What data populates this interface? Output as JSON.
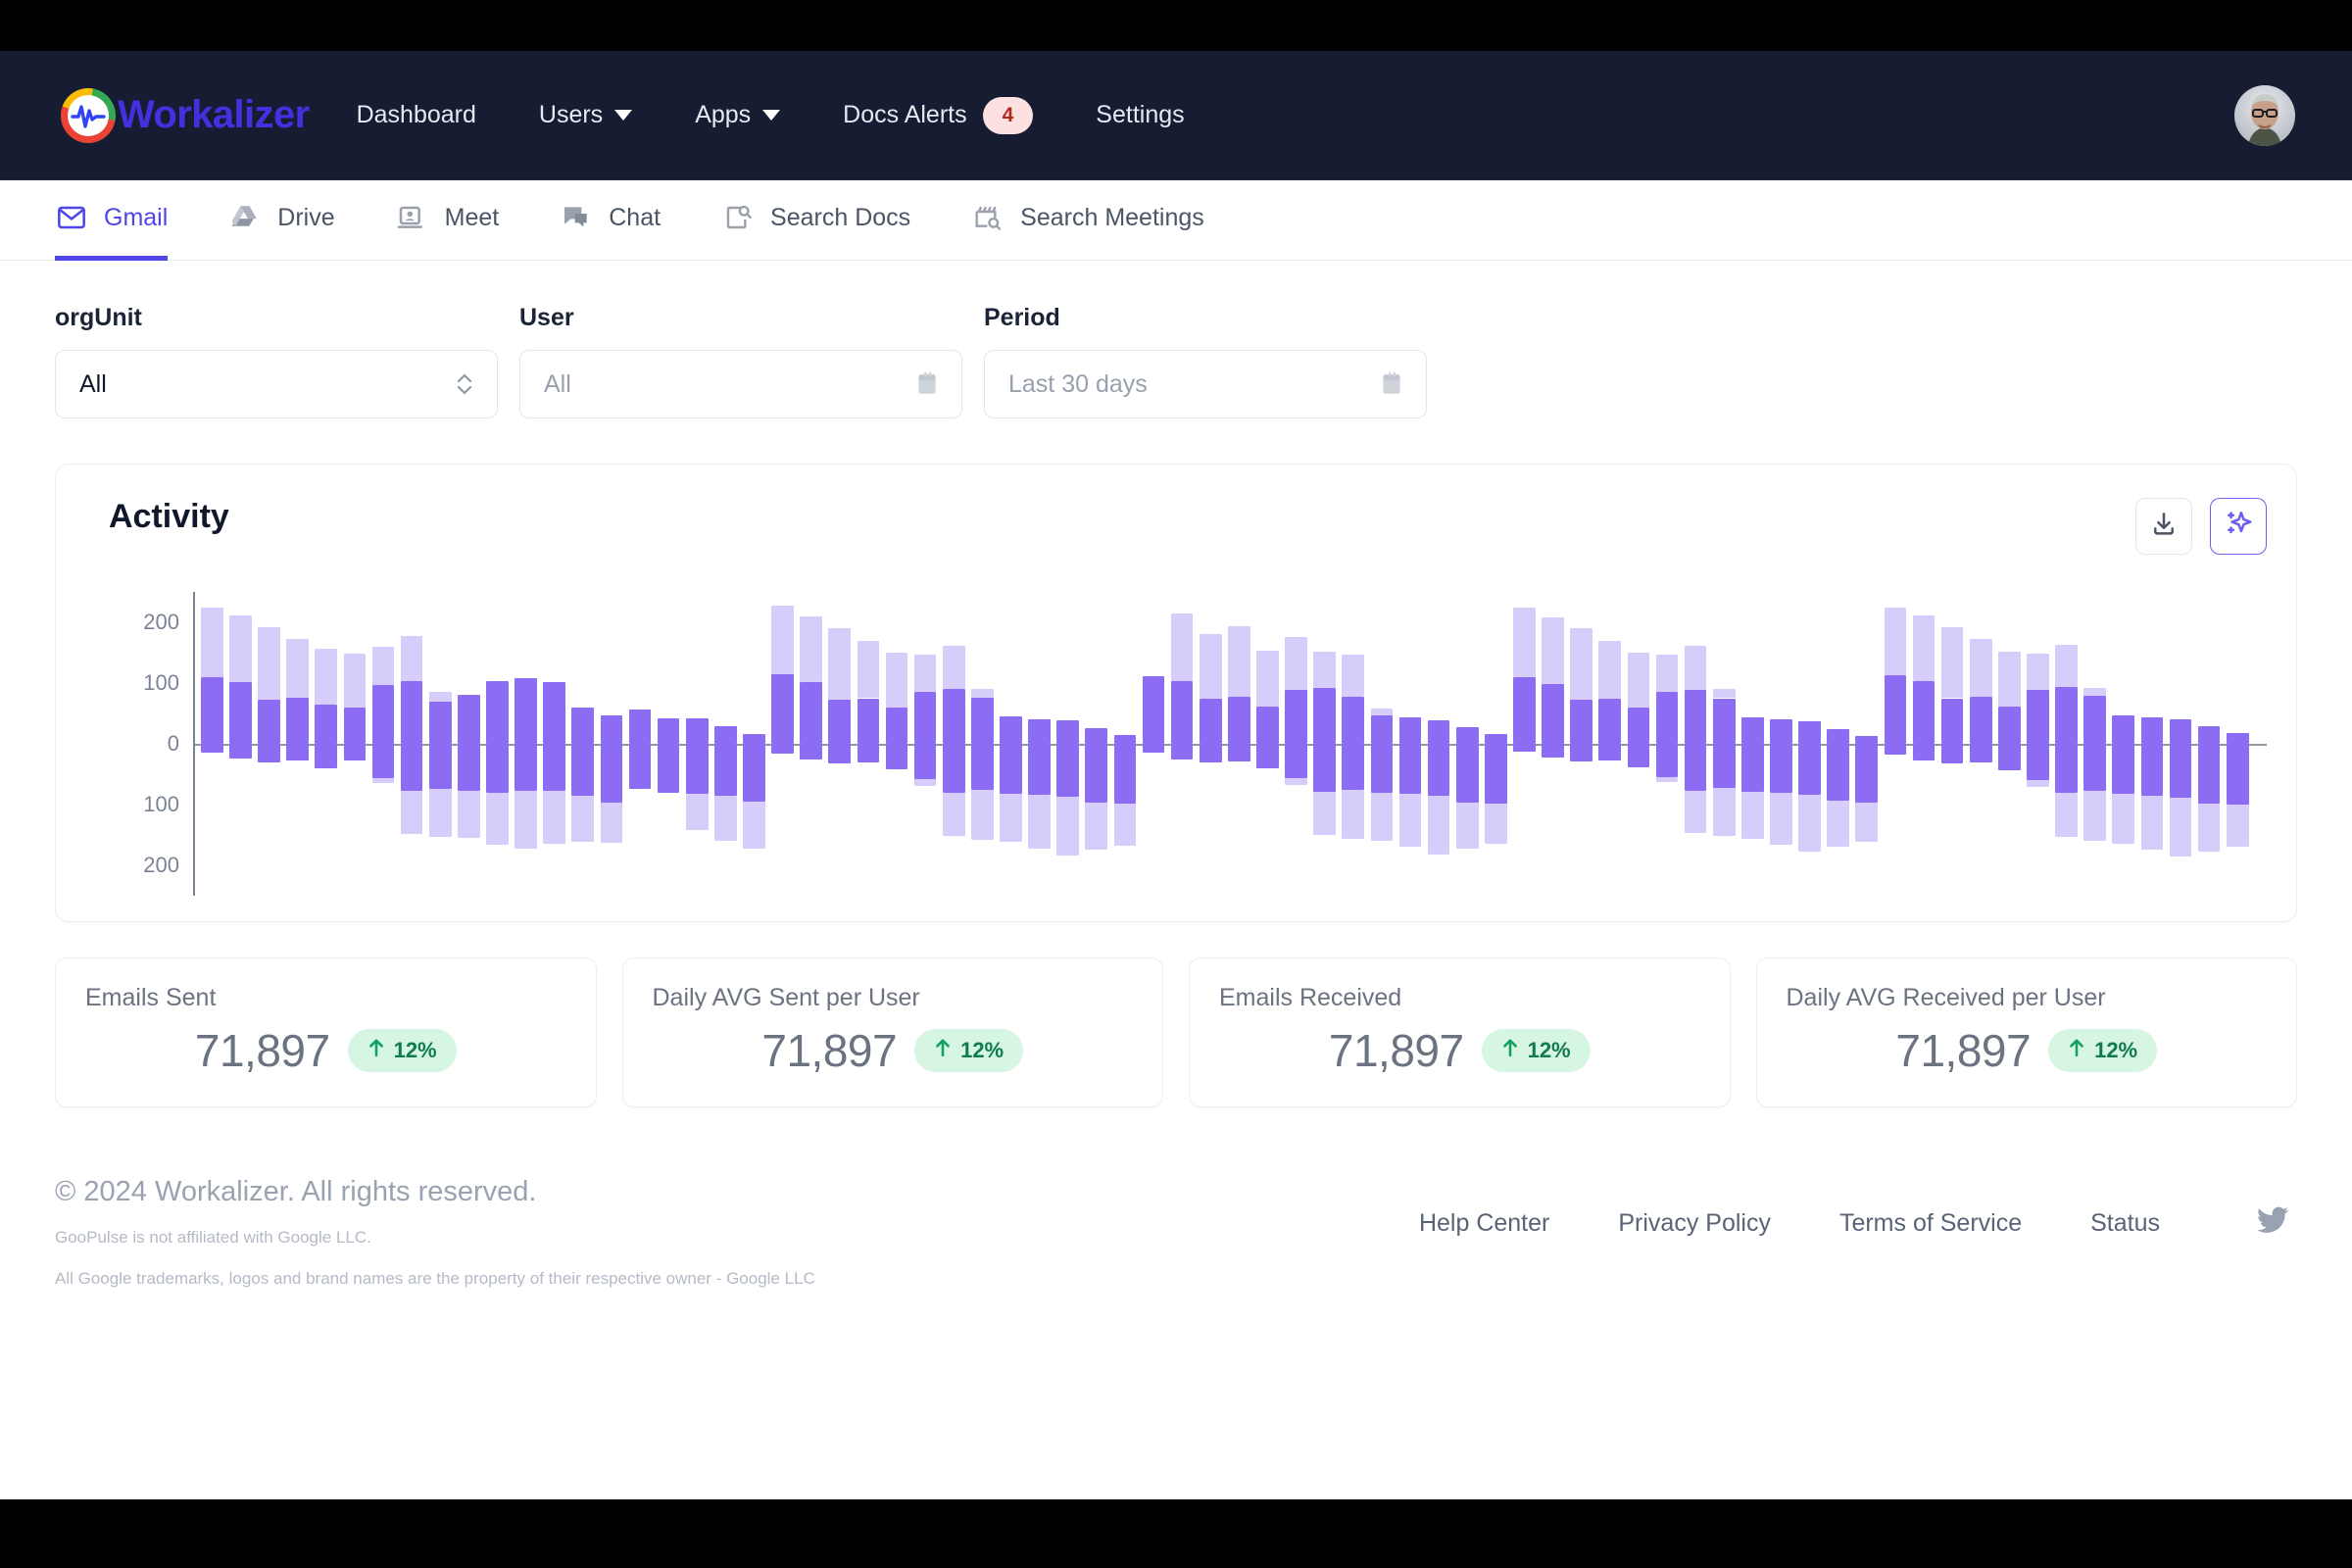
{
  "brand": {
    "name": "Workalizer",
    "logo_icon": "workalizer-pulse-logo"
  },
  "navbar": {
    "links": [
      {
        "label": "Dashboard",
        "caret": false,
        "badge": null
      },
      {
        "label": "Users",
        "caret": true,
        "badge": null
      },
      {
        "label": "Apps",
        "caret": true,
        "badge": null
      },
      {
        "label": "Docs Alerts",
        "caret": false,
        "badge": "4"
      },
      {
        "label": "Settings",
        "caret": false,
        "badge": null
      }
    ],
    "avatar_alt": "user-avatar"
  },
  "tabs": [
    {
      "label": "Gmail",
      "icon": "gmail-envelope-icon",
      "active": true
    },
    {
      "label": "Drive",
      "icon": "drive-triangle-icon",
      "active": false
    },
    {
      "label": "Meet",
      "icon": "meet-camera-icon",
      "active": false
    },
    {
      "label": "Chat",
      "icon": "chat-bubble-icon",
      "active": false
    },
    {
      "label": "Search Docs",
      "icon": "doc-search-icon",
      "active": false
    },
    {
      "label": "Search Meetings",
      "icon": "clapper-search-icon",
      "active": false
    }
  ],
  "filters": {
    "orgUnit": {
      "label": "orgUnit",
      "value": "All",
      "icon": "updown-chevron-icon"
    },
    "user": {
      "label": "User",
      "placeholder": "All",
      "value": "",
      "icon": "calendar-icon"
    },
    "period": {
      "label": "Period",
      "placeholder": "Last 30 days",
      "value": "",
      "icon": "calendar-icon"
    }
  },
  "activity": {
    "title": "Activity",
    "download_icon": "download-icon",
    "ai_icon": "sparkle-ai-icon"
  },
  "chart_data": {
    "type": "bar",
    "title": "Activity",
    "xlabel": "",
    "ylabel": "",
    "ylim": [
      -250,
      250
    ],
    "yticks": [
      200,
      100,
      0,
      100,
      200
    ],
    "ytick_labels": [
      "200",
      "100",
      "0",
      "100",
      "200"
    ],
    "grid": false,
    "legend": null,
    "colors": {
      "sent_dark": "#8c6cf3",
      "sent_light": "#d6cdfa",
      "zero_axis": "#7b8494"
    },
    "description": "Diverging stacked bars: above-zero = emails sent (dark segment) plus light segment; below-zero = emails received (dark segment) plus light segment.",
    "series": [
      {
        "name": "pos_dark",
        "values": [
          110,
          101,
          72,
          76,
          64,
          60,
          96,
          104,
          70,
          81,
          103,
          108,
          101,
          59,
          46,
          56,
          42,
          42,
          29,
          16,
          115,
          101,
          73,
          75,
          60,
          86,
          90,
          76,
          45,
          41,
          38,
          26,
          14,
          112,
          103,
          74,
          77,
          61,
          88,
          92,
          78,
          46,
          43,
          39,
          28,
          16,
          110,
          99,
          72,
          74,
          59,
          85,
          89,
          75,
          44,
          40,
          37,
          25,
          13,
          113,
          104,
          75,
          78,
          62,
          89,
          93,
          79,
          47,
          44,
          40,
          29,
          17
        ]
      },
      {
        "name": "pos_light",
        "values": [
          115,
          110,
          120,
          97,
          92,
          88,
          63,
          73,
          16,
          0,
          0,
          0,
          0,
          0,
          0,
          0,
          0,
          0,
          0,
          0,
          113,
          108,
          118,
          95,
          90,
          61,
          71,
          14,
          0,
          0,
          0,
          0,
          0,
          0,
          111,
          106,
          116,
          93,
          88,
          59,
          69,
          12,
          0,
          0,
          0,
          0,
          114,
          109,
          119,
          96,
          91,
          62,
          72,
          15,
          0,
          0,
          0,
          0,
          0,
          112,
          107,
          117,
          94,
          89,
          60,
          70,
          13,
          0,
          0,
          0,
          0,
          0
        ]
      },
      {
        "name": "neg_dark",
        "values": [
          -14,
          -24,
          -30,
          -28,
          -40,
          -27,
          -56,
          -78,
          -74,
          -77,
          -80,
          -78,
          -77,
          -85,
          -97,
          -74,
          -80,
          -82,
          -85,
          -95,
          -16,
          -26,
          -32,
          -30,
          -42,
          -58,
          -80,
          -76,
          -82,
          -84,
          -87,
          -97,
          -99,
          -15,
          -25,
          -31,
          -29,
          -41,
          -57,
          -79,
          -75,
          -81,
          -83,
          -86,
          -96,
          -98,
          -13,
          -23,
          -29,
          -27,
          -39,
          -55,
          -77,
          -73,
          -79,
          -81,
          -84,
          -94,
          -96,
          -17,
          -27,
          -33,
          -31,
          -43,
          -59,
          -81,
          -77,
          -83,
          -85,
          -88,
          -98,
          -100
        ]
      },
      {
        "name": "neg_light",
        "values": [
          0,
          0,
          0,
          0,
          0,
          0,
          -9,
          -70,
          -80,
          -78,
          -86,
          -95,
          -88,
          -76,
          -66,
          0,
          0,
          -60,
          -75,
          -78,
          0,
          0,
          0,
          0,
          0,
          -11,
          -72,
          -82,
          -80,
          -88,
          -97,
          -78,
          -68,
          0,
          0,
          0,
          0,
          0,
          -10,
          -71,
          -81,
          -79,
          -87,
          -96,
          -77,
          -67,
          0,
          0,
          0,
          0,
          0,
          -8,
          -69,
          -79,
          -77,
          -85,
          -94,
          -75,
          -65,
          0,
          0,
          0,
          0,
          0,
          -12,
          -73,
          -83,
          -81,
          -89,
          -98,
          -79,
          -69
        ]
      }
    ]
  },
  "kpis": [
    {
      "label": "Emails Sent",
      "value": "71,897",
      "delta": "12%",
      "direction": "up"
    },
    {
      "label": "Daily AVG Sent per User",
      "value": "71,897",
      "delta": "12%",
      "direction": "up"
    },
    {
      "label": "Emails Received",
      "value": "71,897",
      "delta": "12%",
      "direction": "up"
    },
    {
      "label": "Daily AVG Received per User",
      "value": "71,897",
      "delta": "12%",
      "direction": "up"
    }
  ],
  "footer": {
    "copyright": "© 2024 Workalizer. All rights reserved.",
    "disclaimer1": "GooPulse is not affiliated with Google LLC.",
    "disclaimer2": "All Google trademarks, logos and brand names are the property of their respective owner - Google LLC",
    "links": [
      "Help Center",
      "Privacy Policy",
      "Terms of Service",
      "Status"
    ],
    "social_icon": "twitter-bird-icon"
  }
}
